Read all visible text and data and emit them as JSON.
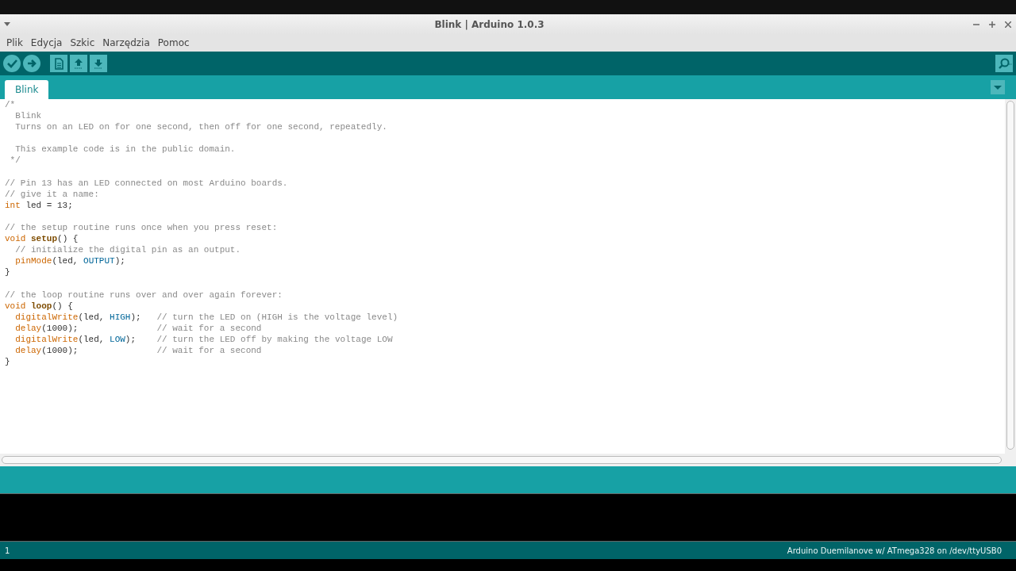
{
  "window": {
    "title": "Blink | Arduino 1.0.3"
  },
  "menu": [
    "Plik",
    "Edycja",
    "Szkic",
    "Narzędzia",
    "Pomoc"
  ],
  "toolbar": [
    {
      "kind": "verify"
    },
    {
      "kind": "upload"
    },
    {
      "kind": "new"
    },
    {
      "kind": "open"
    },
    {
      "kind": "save"
    }
  ],
  "tabs": [
    {
      "label": "Blink",
      "selected": true
    }
  ],
  "code": [
    {
      "kind": "code",
      "tokens": [
        {
          "kind": "comment",
          "text": "/*"
        }
      ]
    },
    {
      "kind": "code",
      "tokens": [
        {
          "kind": "comment",
          "text": "  Blink"
        }
      ]
    },
    {
      "kind": "code",
      "tokens": [
        {
          "kind": "comment",
          "text": "  Turns on an LED on for one second, then off for one second, repeatedly."
        }
      ]
    },
    {
      "kind": "blank"
    },
    {
      "kind": "code",
      "tokens": [
        {
          "kind": "comment",
          "text": "  This example code is in the public domain."
        }
      ]
    },
    {
      "kind": "code",
      "tokens": [
        {
          "kind": "comment",
          "text": " */"
        }
      ]
    },
    {
      "kind": "blank"
    },
    {
      "kind": "code",
      "tokens": [
        {
          "kind": "comment",
          "text": "// Pin 13 has an LED connected on most Arduino boards."
        }
      ]
    },
    {
      "kind": "code",
      "tokens": [
        {
          "kind": "comment",
          "text": "// give it a name:"
        }
      ]
    },
    {
      "kind": "code",
      "tokens": [
        {
          "kind": "type",
          "text": "int"
        },
        {
          "kind": "plain",
          "text": " led = 13;"
        }
      ]
    },
    {
      "kind": "blank"
    },
    {
      "kind": "code",
      "tokens": [
        {
          "kind": "comment",
          "text": "// the setup routine runs once when you press reset:"
        }
      ]
    },
    {
      "kind": "code",
      "tokens": [
        {
          "kind": "type",
          "text": "void "
        },
        {
          "kind": "structure",
          "text": "setup"
        },
        {
          "kind": "plain",
          "text": "() {"
        }
      ]
    },
    {
      "kind": "code",
      "tokens": [
        {
          "kind": "comment",
          "text": "  // initialize the digital pin as an output."
        }
      ]
    },
    {
      "kind": "code",
      "tokens": [
        {
          "kind": "function",
          "text": "  pinMode"
        },
        {
          "kind": "plain",
          "text": "(led, "
        },
        {
          "kind": "constant",
          "text": "OUTPUT"
        },
        {
          "kind": "plain",
          "text": ");"
        }
      ]
    },
    {
      "kind": "code",
      "tokens": [
        {
          "kind": "plain",
          "text": "}"
        }
      ]
    },
    {
      "kind": "blank"
    },
    {
      "kind": "code",
      "tokens": [
        {
          "kind": "comment",
          "text": "// the loop routine runs over and over again forever:"
        }
      ]
    },
    {
      "kind": "code",
      "tokens": [
        {
          "kind": "type",
          "text": "void "
        },
        {
          "kind": "structure",
          "text": "loop"
        },
        {
          "kind": "plain",
          "text": "() {"
        }
      ]
    },
    {
      "kind": "code",
      "tokens": [
        {
          "kind": "function",
          "text": "  digitalWrite"
        },
        {
          "kind": "plain",
          "text": "(led, "
        },
        {
          "kind": "constant",
          "text": "HIGH"
        },
        {
          "kind": "plain",
          "text": ");   "
        },
        {
          "kind": "comment",
          "text": "// turn the LED on (HIGH is the voltage level)"
        }
      ]
    },
    {
      "kind": "code",
      "tokens": [
        {
          "kind": "function",
          "text": "  delay"
        },
        {
          "kind": "plain",
          "text": "(1000);               "
        },
        {
          "kind": "comment",
          "text": "// wait for a second"
        }
      ]
    },
    {
      "kind": "code",
      "tokens": [
        {
          "kind": "function",
          "text": "  digitalWrite"
        },
        {
          "kind": "plain",
          "text": "(led, "
        },
        {
          "kind": "constant",
          "text": "LOW"
        },
        {
          "kind": "plain",
          "text": ");    "
        },
        {
          "kind": "comment",
          "text": "// turn the LED off by making the voltage LOW"
        }
      ]
    },
    {
      "kind": "code",
      "tokens": [
        {
          "kind": "function",
          "text": "  delay"
        },
        {
          "kind": "plain",
          "text": "(1000);               "
        },
        {
          "kind": "comment",
          "text": "// wait for a second"
        }
      ]
    },
    {
      "kind": "code",
      "tokens": [
        {
          "kind": "plain",
          "text": "}"
        }
      ]
    }
  ],
  "status_bar": {
    "line": "1",
    "board": "Arduino Duemilanove w/ ATmega328 on /dev/ttyUSB0"
  }
}
